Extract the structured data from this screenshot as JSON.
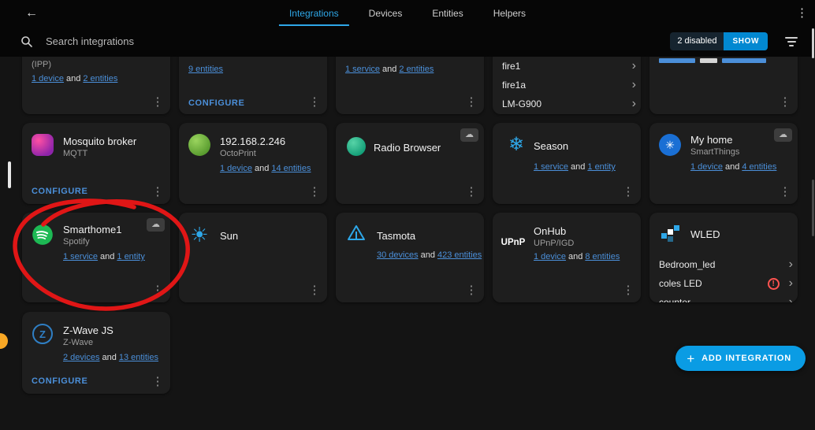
{
  "colors": {
    "background": "#141414",
    "topbar": "#060606",
    "card": "#1e1e1e",
    "accent": "#2ea7e8",
    "link": "#4b8fd9",
    "button": "#0a9ce4",
    "show_badge": "#16242f",
    "show_button": "#0288d1",
    "muted": "#9e9e9e",
    "error": "#ff5350",
    "annotation": "#e01616"
  },
  "icons": {
    "back": "←",
    "kebab": "⋮",
    "cloud": "☁",
    "chevron": "›",
    "plus": "+",
    "snowflake": "❄",
    "sun": "☀",
    "smartthings_star": "✳",
    "error_mark": "!"
  },
  "header": {
    "tabs": [
      {
        "label": "Integrations",
        "active": true
      },
      {
        "label": "Devices",
        "active": false
      },
      {
        "label": "Entities",
        "active": false
      },
      {
        "label": "Helpers",
        "active": false
      }
    ]
  },
  "search": {
    "placeholder": "Search integrations",
    "disabled_badge": "2 disabled",
    "show_label": "SHOW"
  },
  "cards": {
    "ipp": {
      "subtitle": "(IPP)",
      "link_a": "1 device",
      "and": "and",
      "link_b": "2 entities"
    },
    "unknown2": {
      "link_b": "9 entities",
      "configure": "CONFIGURE"
    },
    "unknown3": {
      "link_a": "1 service",
      "and": "and",
      "link_b": "2 entities"
    },
    "fire": {
      "devices": [
        "fire1",
        "fire1a",
        "LM-G900"
      ]
    },
    "mqtt": {
      "title": "Mosquito broker",
      "subtitle": "MQTT",
      "configure": "CONFIGURE"
    },
    "octoprint": {
      "title": "192.168.2.246",
      "subtitle": "OctoPrint",
      "link_a": "1 device",
      "and": "and",
      "link_b": "14 entities"
    },
    "radio_browser": {
      "title": "Radio Browser"
    },
    "season": {
      "title": "Season",
      "link_a": "1 service",
      "and": "and",
      "link_b": "1 entity"
    },
    "smartthings": {
      "title": "My home",
      "subtitle": "SmartThings",
      "link_a": "1 device",
      "and": "and",
      "link_b": "4 entities"
    },
    "spotify": {
      "title": "Smarthome1",
      "subtitle": "Spotify",
      "link_a": "1 service",
      "and": "and",
      "link_b": "1 entity"
    },
    "sun": {
      "title": "Sun"
    },
    "tasmota": {
      "title": "Tasmota",
      "link_a": "30 devices",
      "and": "and",
      "link_b": "423 entities"
    },
    "onhub": {
      "title": "OnHub",
      "subtitle": "UPnP/IGD",
      "icon_text": "UPnP",
      "link_a": "1 device",
      "and": "and",
      "link_b": "8 entities"
    },
    "wled": {
      "title": "WLED",
      "devices": [
        {
          "name": "Bedroom_led"
        },
        {
          "name": "coles LED",
          "error": true
        },
        {
          "name": "counter"
        }
      ]
    },
    "zwave": {
      "title": "Z-Wave JS",
      "subtitle": "Z-Wave",
      "link_a": "2 devices",
      "and": "and",
      "link_b": "13 entities",
      "configure": "CONFIGURE"
    }
  },
  "fab": {
    "label": "ADD INTEGRATION"
  }
}
